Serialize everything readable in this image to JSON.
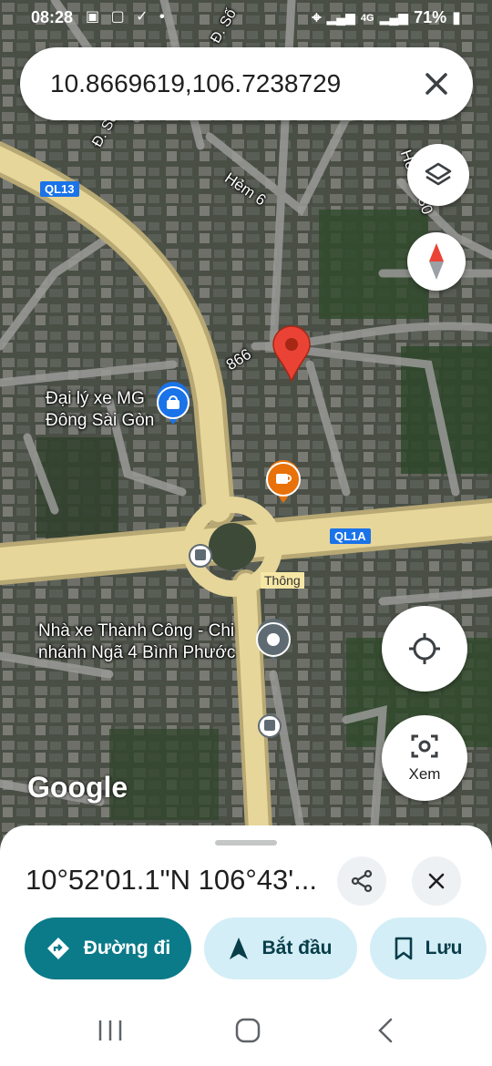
{
  "status_bar": {
    "time": "08:28",
    "battery": "71%",
    "network": "4G"
  },
  "search": {
    "query": "10.8669619,106.7238729"
  },
  "map": {
    "road_labels": [
      "QL13",
      "Hẻm 6",
      "Hẻm 6/30",
      "866",
      "QL1A",
      "Thông",
      "Đ. Số"
    ],
    "places": [
      {
        "name_line1": "Đại lý xe MG",
        "name_line2": "Đông Sài Gòn"
      },
      {
        "name_line1": "Nhà xe Thành Công - Chi",
        "name_line2": "nhánh Ngã 4 Bình Phước"
      }
    ],
    "google_logo": "Google",
    "street_view_label": "Xem"
  },
  "sheet": {
    "coordinates": "10°52'01.1\"N 106°43'...",
    "directions_label": "Đường đi",
    "start_label": "Bắt đầu",
    "save_label": "Lưu"
  },
  "colors": {
    "accent": "#0b7a89",
    "pin": "#ea4335",
    "road": "#e6d69a",
    "pill_light": "#d3eef6"
  }
}
